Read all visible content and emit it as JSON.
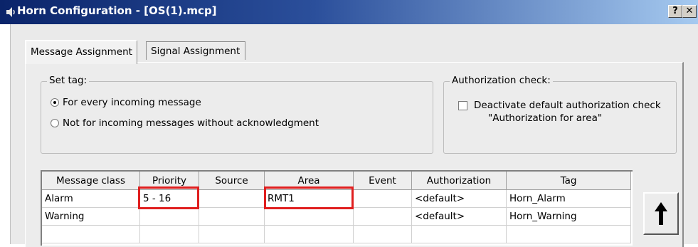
{
  "window": {
    "title": "Horn Configuration - [OS(1).mcp]",
    "help_label": "?",
    "close_label": "✕"
  },
  "tabs": [
    {
      "label": "Message Assignment",
      "active": true
    },
    {
      "label": "Signal Assignment",
      "active": false
    }
  ],
  "set_tag": {
    "legend": "Set tag:",
    "options": [
      {
        "label": "For every incoming message",
        "selected": true
      },
      {
        "label": "Not for incoming messages without acknowledgment",
        "selected": false
      }
    ]
  },
  "authorization_check": {
    "legend": "Authorization check:",
    "checkbox_label": "Deactivate default authorization check",
    "checkbox_label_2": "\"Authorization for area\"",
    "checked": false
  },
  "table": {
    "columns": [
      "Message class",
      "Priority",
      "Source",
      "Area",
      "Event",
      "Authorization",
      "Tag"
    ],
    "rows": [
      [
        "Alarm",
        "5 - 16",
        "",
        "RMT1",
        "",
        "<default>",
        "Horn_Alarm"
      ],
      [
        "Warning",
        "",
        "",
        "",
        "",
        "<default>",
        "Horn_Warning"
      ],
      [
        "",
        "",
        "",
        "",
        "",
        "",
        ""
      ]
    ]
  },
  "icons": {
    "title_icon": "speaker-icon",
    "move_up": "arrow-up-icon"
  },
  "colors": {
    "titlebar_start": "#0a246a",
    "titlebar_end": "#a6caf0",
    "highlight": "#e01f1f"
  }
}
